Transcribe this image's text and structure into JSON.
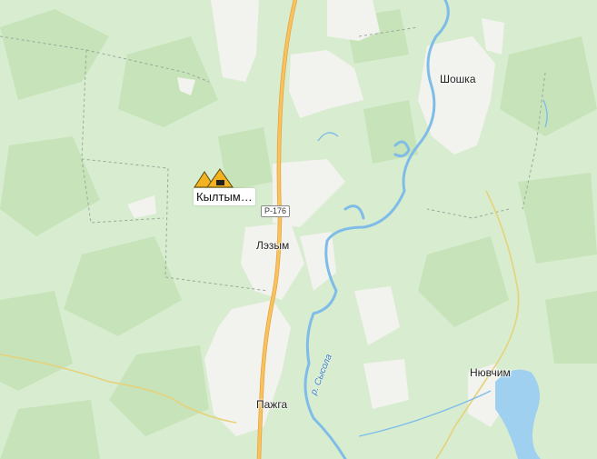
{
  "map": {
    "road_number": "Р-176",
    "poi": {
      "name": "Кылтым…",
      "icon": "mountain-resort-icon"
    },
    "settlements": [
      "Шошка",
      "Лэзым",
      "Пажга",
      "Нювчим"
    ],
    "river": "р. Сысола",
    "colors": {
      "forest_light": "#d8ecd0",
      "forest_dark": "#c4e2b6",
      "settlement": "#f3f3ef",
      "water": "#9fd0f0",
      "road": "#f5b74e",
      "boundary": "#9aa89a"
    }
  }
}
